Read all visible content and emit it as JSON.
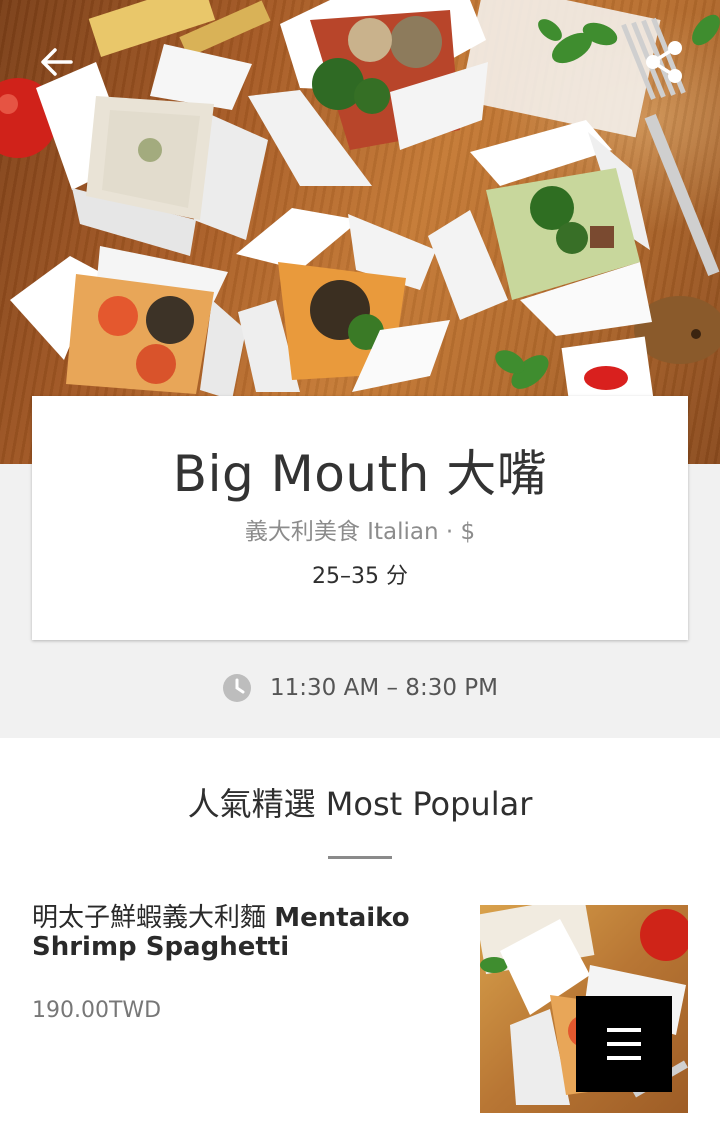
{
  "header": {
    "back_icon": "arrow-left-icon",
    "share_icon": "share-icon"
  },
  "restaurant": {
    "name": "Big Mouth 大嘴",
    "cuisine_line": "義大利美食 Italian · $",
    "delivery_time": "25–35 分",
    "hours": "11:30 AM – 8:30 PM",
    "hours_icon": "clock-icon"
  },
  "section": {
    "title": "人氣精選 Most Popular"
  },
  "items": [
    {
      "title_zh": "明太子鮮蝦義大利麵",
      "title_en": "Mentaiko Shrimp Spaghetti",
      "price": "190.00TWD"
    }
  ],
  "menu_button": {
    "icon": "menu-icon"
  },
  "colors": {
    "band_bg": "#f1f1f1",
    "fab_bg": "#000000",
    "text_dark": "#2b2b2b",
    "text_muted": "#8c8c8c"
  }
}
